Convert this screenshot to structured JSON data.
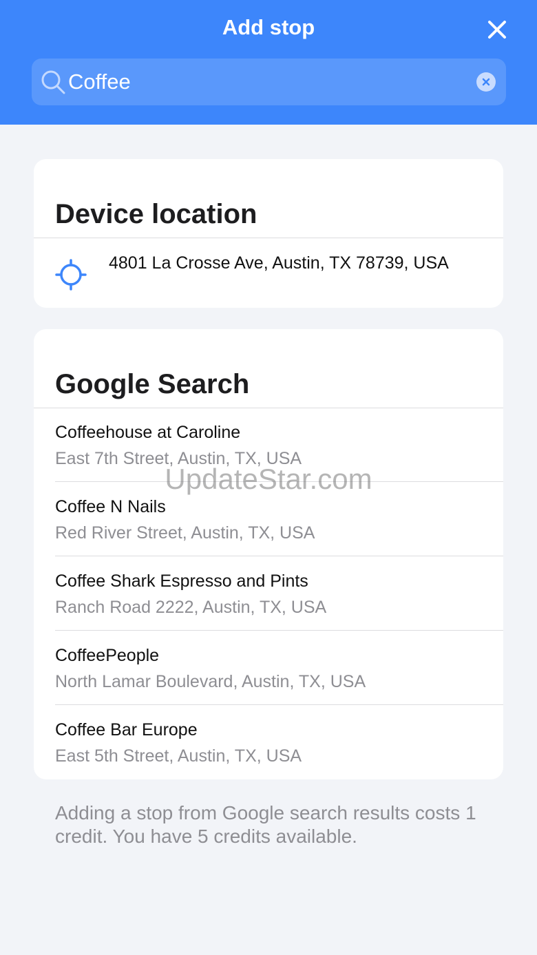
{
  "header": {
    "title": "Add stop",
    "close_icon": "close-icon",
    "background": "#3d86fb"
  },
  "search": {
    "value": "Coffee",
    "placeholder": "Search",
    "search_icon": "search-icon",
    "clear_icon": "clear-icon"
  },
  "device_location": {
    "heading": "Device location",
    "icon": "crosshair-icon",
    "address": "4801 La Crosse Ave, Austin, TX 78739, USA",
    "accent": "#3d86fb"
  },
  "google_search": {
    "heading": "Google Search",
    "results": [
      {
        "name": "Coffeehouse at Caroline",
        "address": "East 7th Street, Austin, TX, USA"
      },
      {
        "name": "Coffee N Nails",
        "address": "Red River Street, Austin, TX, USA"
      },
      {
        "name": "Coffee Shark Espresso and Pints",
        "address": "Ranch Road 2222, Austin, TX, USA"
      },
      {
        "name": "CoffeePeople",
        "address": "North Lamar Boulevard, Austin, TX, USA"
      },
      {
        "name": "Coffee Bar Europe",
        "address": "East 5th Street, Austin, TX, USA"
      }
    ]
  },
  "footer": {
    "note": "Adding a stop from Google search results costs 1 credit. You have 5 credits available."
  },
  "watermark": "UpdateStar.com"
}
